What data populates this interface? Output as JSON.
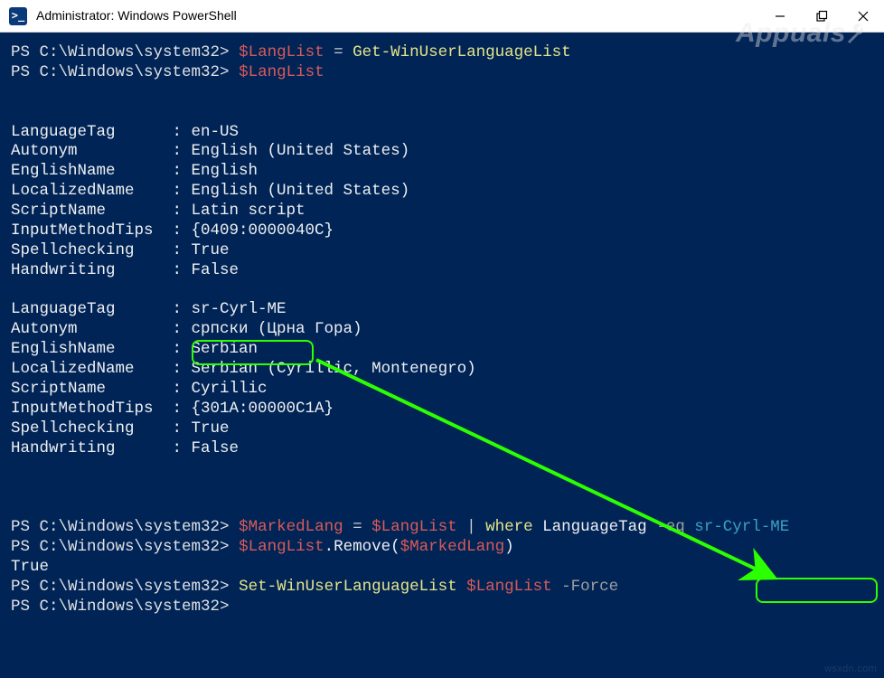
{
  "window": {
    "title": "Administrator: Windows PowerShell",
    "icon_label": ">_"
  },
  "watermark": {
    "text": "Appuals"
  },
  "attribution": "wsxdn.com",
  "prompt": "PS C:\\Windows\\system32>",
  "cmd1": {
    "var": "$LangList",
    "eq": " = ",
    "rhs": "Get-WinUserLanguageList"
  },
  "cmd2": {
    "var": "$LangList"
  },
  "lang1": {
    "tag": "LanguageTag      : en-US",
    "autonym": "Autonym          : English (United States)",
    "english": "EnglishName      : English",
    "localized": "LocalizedName    : English (United States)",
    "script": "ScriptName       : Latin script",
    "imt": "InputMethodTips  : {0409:0000040C}",
    "spell": "Spellchecking    : True",
    "hand": "Handwriting      : False"
  },
  "lang2": {
    "tag_label": "LanguageTag      : ",
    "tag_value": "sr-Cyrl-ME",
    "autonym": "Autonym          : српски (Црна Гора)",
    "english": "EnglishName      : Serbian",
    "localized": "LocalizedName    : Serbian (Cyrillic, Montenegro)",
    "script": "ScriptName       : Cyrillic",
    "imt": "InputMethodTips  : {301A:00000C1A}",
    "spell": "Spellchecking    : True",
    "hand": "Handwriting      : False"
  },
  "cmd3": {
    "var": "$MarkedLang",
    "eq": " = ",
    "rhs1": "$LangList",
    "pipe": " | ",
    "where": "where",
    "prop": " LanguageTag ",
    "op": "-eq",
    "sp": " ",
    "val": "sr-Cyrl-ME"
  },
  "cmd4": {
    "var": "$LangList",
    "method": ".Remove(",
    "arg": "$MarkedLang",
    "close": ")"
  },
  "cmd4_out": "True",
  "cmd5": {
    "cmd": "Set-WinUserLanguageList",
    "sp1": " ",
    "arg": "$LangList",
    "sp2": " ",
    "opt": "-Force"
  }
}
